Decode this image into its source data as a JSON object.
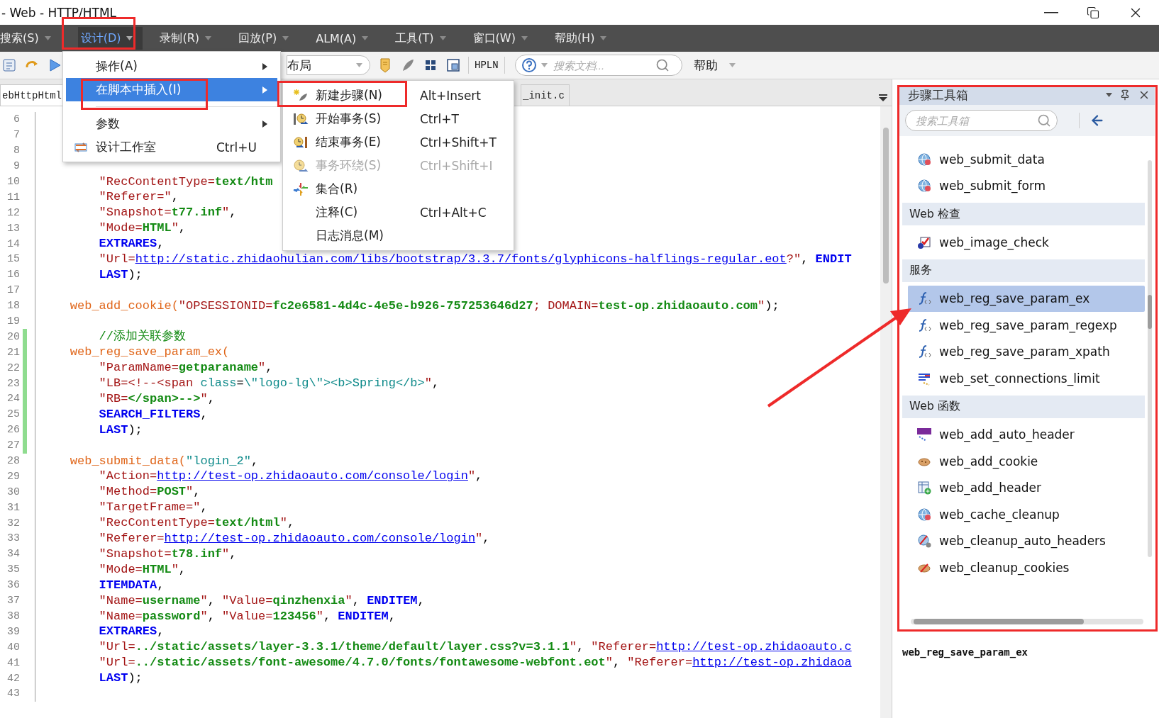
{
  "window": {
    "title": "- Web - HTTP/HTML"
  },
  "menu_bar": [
    {
      "label": "搜索(S)",
      "selected": false
    },
    {
      "label": "设计(D)",
      "selected": true
    },
    {
      "label": "录制(R)",
      "selected": false
    },
    {
      "label": "回放(P)",
      "selected": false
    },
    {
      "label": "ALM(A)",
      "selected": false
    },
    {
      "label": "工具(T)",
      "selected": false
    },
    {
      "label": "窗口(W)",
      "selected": false
    },
    {
      "label": "帮助(H)",
      "selected": false
    }
  ],
  "toolbar": {
    "layout_select": "布局",
    "hpln": "HPLN",
    "search_placeholder": "搜索文档...",
    "help": "帮助"
  },
  "tabs": [
    {
      "label": "ebHttpHtml",
      "selected": true
    },
    {
      "label": "_init.c",
      "selected": false
    }
  ],
  "editor": {
    "lines": [
      {
        "n": "6",
        "modified": false
      },
      {
        "n": "7",
        "modified": false
      },
      {
        "n": "8",
        "modified": false
      },
      {
        "n": "9",
        "modified": false
      },
      {
        "n": "10",
        "modified": false,
        "code": [
          {
            "kind": "key",
            "text": "        \"RecContentType="
          },
          {
            "kind": "value",
            "text": "text/htm"
          }
        ]
      },
      {
        "n": "11",
        "modified": false,
        "code": [
          {
            "kind": "key",
            "text": "        \"Referer=\""
          },
          {
            "kind": "plain",
            "text": ","
          }
        ]
      },
      {
        "n": "12",
        "modified": false,
        "code": [
          {
            "kind": "key",
            "text": "        \"Snapshot="
          },
          {
            "kind": "value",
            "text": "t77.inf"
          },
          {
            "kind": "key",
            "text": "\""
          },
          {
            "kind": "plain",
            "text": ","
          }
        ]
      },
      {
        "n": "13",
        "modified": false,
        "code": [
          {
            "kind": "key",
            "text": "        \"Mode="
          },
          {
            "kind": "value",
            "text": "HTML"
          },
          {
            "kind": "key",
            "text": "\""
          },
          {
            "kind": "plain",
            "text": ","
          }
        ]
      },
      {
        "n": "14",
        "modified": false,
        "code": [
          {
            "kind": "keyword",
            "text": "        EXTRARES"
          },
          {
            "kind": "plain",
            "text": ","
          }
        ]
      },
      {
        "n": "15",
        "modified": false,
        "code": [
          {
            "kind": "key",
            "text": "        \"Url="
          },
          {
            "kind": "url",
            "text": "http://static.zhidaohulian.com/libs/bootstrap/3.3.7/fonts/glyphicons-halflings-regular.eot"
          },
          {
            "kind": "key",
            "text": "?\""
          },
          {
            "kind": "plain",
            "text": ", "
          },
          {
            "kind": "keyword",
            "text": "ENDIT"
          }
        ]
      },
      {
        "n": "16",
        "modified": false,
        "code": [
          {
            "kind": "keyword",
            "text": "        LAST"
          },
          {
            "kind": "plain",
            "text": ");"
          }
        ]
      },
      {
        "n": "17",
        "modified": false
      },
      {
        "n": "18",
        "modified": false,
        "code": [
          {
            "kind": "function",
            "text": "    web_add_cookie("
          },
          {
            "kind": "key",
            "text": "\"OPSESSIONID="
          },
          {
            "kind": "value",
            "text": "fc2e6581-4d4c-4e5e-b926-757253646d27"
          },
          {
            "kind": "key",
            "text": "; DOMAIN="
          },
          {
            "kind": "value",
            "text": "test-op.zhidaoauto.com"
          },
          {
            "kind": "key",
            "text": "\""
          },
          {
            "kind": "plain",
            "text": ");"
          }
        ]
      },
      {
        "n": "19",
        "modified": false
      },
      {
        "n": "20",
        "modified": true,
        "code": [
          {
            "kind": "comment",
            "text": "        //添加关联参数"
          }
        ]
      },
      {
        "n": "21",
        "modified": true,
        "code": [
          {
            "kind": "function",
            "text": "    web_reg_save_param_ex("
          }
        ]
      },
      {
        "n": "22",
        "modified": true,
        "code": [
          {
            "kind": "key",
            "text": "        \"ParamName="
          },
          {
            "kind": "value",
            "text": "getparaname"
          },
          {
            "kind": "key",
            "text": "\""
          },
          {
            "kind": "plain",
            "text": ","
          }
        ]
      },
      {
        "n": "23",
        "modified": true,
        "code": [
          {
            "kind": "key",
            "text": "        \"LB=<!--<span"
          },
          {
            "kind": "literal",
            "text": " class"
          },
          {
            "kind": "plain",
            "text": "="
          },
          {
            "kind": "literal",
            "text": "\\\"logo-lg\\\"><b>Spring</b>"
          },
          {
            "kind": "key",
            "text": "\""
          },
          {
            "kind": "plain",
            "text": ","
          }
        ]
      },
      {
        "n": "24",
        "modified": true,
        "code": [
          {
            "kind": "key",
            "text": "        \"RB="
          },
          {
            "kind": "value",
            "text": "</span>-->"
          },
          {
            "kind": "key",
            "text": "\""
          },
          {
            "kind": "plain",
            "text": ","
          }
        ]
      },
      {
        "n": "25",
        "modified": true,
        "code": [
          {
            "kind": "keyword",
            "text": "        SEARCH_FILTERS"
          },
          {
            "kind": "plain",
            "text": ","
          }
        ]
      },
      {
        "n": "26",
        "modified": true,
        "code": [
          {
            "kind": "keyword",
            "text": "        LAST"
          },
          {
            "kind": "plain",
            "text": ");"
          }
        ]
      },
      {
        "n": "27",
        "modified": true
      },
      {
        "n": "28",
        "modified": false,
        "code": [
          {
            "kind": "function",
            "text": "    web_submit_data("
          },
          {
            "kind": "literal",
            "text": "\"login_2\""
          },
          {
            "kind": "plain",
            "text": ","
          }
        ]
      },
      {
        "n": "29",
        "modified": false,
        "code": [
          {
            "kind": "key",
            "text": "        \"Action="
          },
          {
            "kind": "url",
            "text": "http://test-op.zhidaoauto.com/console/login"
          },
          {
            "kind": "key",
            "text": "\""
          },
          {
            "kind": "plain",
            "text": ","
          }
        ]
      },
      {
        "n": "30",
        "modified": false,
        "code": [
          {
            "kind": "key",
            "text": "        \"Method="
          },
          {
            "kind": "value",
            "text": "POST"
          },
          {
            "kind": "key",
            "text": "\""
          },
          {
            "kind": "plain",
            "text": ","
          }
        ]
      },
      {
        "n": "31",
        "modified": false,
        "code": [
          {
            "kind": "key",
            "text": "        \"TargetFrame=\""
          },
          {
            "kind": "plain",
            "text": ","
          }
        ]
      },
      {
        "n": "32",
        "modified": false,
        "code": [
          {
            "kind": "key",
            "text": "        \"RecContentType="
          },
          {
            "kind": "value",
            "text": "text/html"
          },
          {
            "kind": "key",
            "text": "\""
          },
          {
            "kind": "plain",
            "text": ","
          }
        ]
      },
      {
        "n": "33",
        "modified": false,
        "code": [
          {
            "kind": "key",
            "text": "        \"Referer="
          },
          {
            "kind": "url",
            "text": "http://test-op.zhidaoauto.com/console/login"
          },
          {
            "kind": "key",
            "text": "\""
          },
          {
            "kind": "plain",
            "text": ","
          }
        ]
      },
      {
        "n": "34",
        "modified": false,
        "code": [
          {
            "kind": "key",
            "text": "        \"Snapshot="
          },
          {
            "kind": "value",
            "text": "t78.inf"
          },
          {
            "kind": "key",
            "text": "\""
          },
          {
            "kind": "plain",
            "text": ","
          }
        ]
      },
      {
        "n": "35",
        "modified": false,
        "code": [
          {
            "kind": "key",
            "text": "        \"Mode="
          },
          {
            "kind": "value",
            "text": "HTML"
          },
          {
            "kind": "key",
            "text": "\""
          },
          {
            "kind": "plain",
            "text": ","
          }
        ]
      },
      {
        "n": "36",
        "modified": false,
        "code": [
          {
            "kind": "keyword",
            "text": "        ITEMDATA"
          },
          {
            "kind": "plain",
            "text": ","
          }
        ]
      },
      {
        "n": "37",
        "modified": false,
        "code": [
          {
            "kind": "key",
            "text": "        \"Name="
          },
          {
            "kind": "value",
            "text": "username"
          },
          {
            "kind": "key",
            "text": "\""
          },
          {
            "kind": "plain",
            "text": ", "
          },
          {
            "kind": "key",
            "text": "\"Value="
          },
          {
            "kind": "value",
            "text": "qinzhenxia"
          },
          {
            "kind": "key",
            "text": "\""
          },
          {
            "kind": "plain",
            "text": ", "
          },
          {
            "kind": "keyword",
            "text": "ENDITEM"
          },
          {
            "kind": "plain",
            "text": ","
          }
        ]
      },
      {
        "n": "38",
        "modified": false,
        "code": [
          {
            "kind": "key",
            "text": "        \"Name="
          },
          {
            "kind": "value",
            "text": "password"
          },
          {
            "kind": "key",
            "text": "\""
          },
          {
            "kind": "plain",
            "text": ", "
          },
          {
            "kind": "key",
            "text": "\"Value="
          },
          {
            "kind": "value",
            "text": "123456"
          },
          {
            "kind": "key",
            "text": "\""
          },
          {
            "kind": "plain",
            "text": ", "
          },
          {
            "kind": "keyword",
            "text": "ENDITEM"
          },
          {
            "kind": "plain",
            "text": ","
          }
        ]
      },
      {
        "n": "39",
        "modified": false,
        "code": [
          {
            "kind": "keyword",
            "text": "        EXTRARES"
          },
          {
            "kind": "plain",
            "text": ","
          }
        ]
      },
      {
        "n": "40",
        "modified": false,
        "code": [
          {
            "kind": "key",
            "text": "        \"Url="
          },
          {
            "kind": "value",
            "text": "../static/assets/layer-3.3.1/theme/default/layer.css?v=3.1.1"
          },
          {
            "kind": "key",
            "text": "\""
          },
          {
            "kind": "plain",
            "text": ", "
          },
          {
            "kind": "key",
            "text": "\"Referer="
          },
          {
            "kind": "url",
            "text": "http://test-op.zhidaoauto.c"
          }
        ]
      },
      {
        "n": "41",
        "modified": false,
        "code": [
          {
            "kind": "key",
            "text": "        \"Url="
          },
          {
            "kind": "value",
            "text": "../static/assets/font-awesome/4.7.0/fonts/fontawesome-webfont.eot"
          },
          {
            "kind": "key",
            "text": "\""
          },
          {
            "kind": "plain",
            "text": ", "
          },
          {
            "kind": "key",
            "text": "\"Referer="
          },
          {
            "kind": "url",
            "text": "http://test-op.zhidaoa"
          }
        ]
      },
      {
        "n": "42",
        "modified": false,
        "code": [
          {
            "kind": "keyword",
            "text": "        LAST"
          },
          {
            "kind": "plain",
            "text": ");"
          }
        ]
      },
      {
        "n": "43",
        "modified": false
      }
    ]
  },
  "design_menu": [
    {
      "kind": "item",
      "label": "操作(A)",
      "has_submenu": true,
      "selected": false
    },
    {
      "kind": "item",
      "label": "在脚本中插入(I)",
      "has_submenu": true,
      "selected": true
    },
    {
      "kind": "separator"
    },
    {
      "kind": "item",
      "label": "参数",
      "has_submenu": true,
      "selected": false
    },
    {
      "kind": "item",
      "label": "设计工作室",
      "shortcut": "Ctrl+U",
      "has_submenu": false,
      "selected": false
    }
  ],
  "insert_submenu": [
    {
      "label": "新建步骤(N)",
      "shortcut": "Alt+Insert",
      "disabled": false,
      "selected": false
    },
    {
      "label": "开始事务(S)",
      "shortcut": "Ctrl+T",
      "disabled": false,
      "selected": false
    },
    {
      "label": "结束事务(E)",
      "shortcut": "Ctrl+Shift+T",
      "disabled": false,
      "selected": false
    },
    {
      "label": "事务环绕(S)",
      "shortcut": "Ctrl+Shift+I",
      "disabled": true,
      "selected": false
    },
    {
      "label": "集合(R)",
      "disabled": false,
      "selected": false
    },
    {
      "label": "注释(C)",
      "shortcut": "Ctrl+Alt+C",
      "disabled": false,
      "selected": false
    },
    {
      "label": "日志消息(M)",
      "disabled": false,
      "selected": false
    }
  ],
  "toolbox": {
    "title": "步骤工具箱",
    "search_placeholder": "搜索工具箱",
    "entries": [
      {
        "kind": "item",
        "label": "web_submit_data",
        "selected": false
      },
      {
        "kind": "item",
        "label": "web_submit_form",
        "selected": false
      },
      {
        "kind": "group",
        "label": "Web 检查"
      },
      {
        "kind": "item",
        "label": "web_image_check",
        "selected": false
      },
      {
        "kind": "group",
        "label": "服务"
      },
      {
        "kind": "item",
        "label": "web_reg_save_param_ex",
        "selected": true
      },
      {
        "kind": "item",
        "label": "web_reg_save_param_regexp",
        "selected": false
      },
      {
        "kind": "item",
        "label": "web_reg_save_param_xpath",
        "selected": false
      },
      {
        "kind": "item",
        "label": "web_set_connections_limit",
        "selected": false
      },
      {
        "kind": "group",
        "label": "Web 函数"
      },
      {
        "kind": "item",
        "label": "web_add_auto_header",
        "selected": false
      },
      {
        "kind": "item",
        "label": "web_add_cookie",
        "selected": false
      },
      {
        "kind": "item",
        "label": "web_add_header",
        "selected": false
      },
      {
        "kind": "item",
        "label": "web_cache_cleanup",
        "selected": false
      },
      {
        "kind": "item",
        "label": "web_cleanup_auto_headers",
        "selected": false
      },
      {
        "kind": "item",
        "label": "web_cleanup_cookies",
        "selected": false
      }
    ],
    "description": "web_reg_save_param_ex"
  }
}
